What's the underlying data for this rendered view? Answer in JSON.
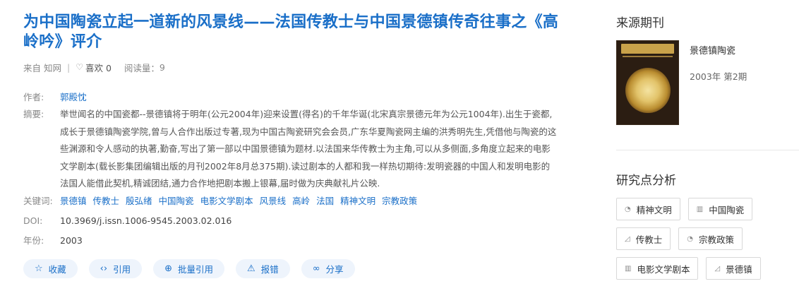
{
  "article": {
    "title": "为中国陶瓷立起一道新的风景线——法国传教士与中国景德镇传奇往事之《高岭吟》评介",
    "source": "来自 知网",
    "separator": "|",
    "like_label": "喜欢 0",
    "read_label": "阅读量：",
    "read_count": "9"
  },
  "fields": {
    "author_label": "作者:",
    "author": "郭殿忱",
    "abstract_label": "摘要:",
    "abstract": "举世闻名的中国瓷都--景德镇将于明年(公元2004年)迎来设置(得名)的千年华诞(北宋真宗景德元年为公元1004年).出生于瓷都,成长于景德镇陶瓷学院,曾与人合作出版过专著,现为中国古陶瓷研究会会员,广东华夏陶瓷网主编的洪秀明先生,凭借他与陶瓷的这些渊源和令人感动的执著,勤奋,写出了第一部以中国景德镇为题材.以法国来华传教士为主角,可以从多侧面,多角度立起来的电影文学剧本(载长影集团编辑出版的月刊2002年8月总375期).读过剧本的人都和我一样热切期待:发明瓷器的中国人和发明电影的法国人能借此契机,精诚团结,通力合作地把剧本搬上银幕,届时做为庆典献礼片公映.",
    "keywords_label": "关键词:",
    "keywords": [
      "景德镇",
      "传教士",
      "殷弘绪",
      "中国陶瓷",
      "电影文学剧本",
      "风景线",
      "高岭",
      "法国",
      "精神文明",
      "宗教政策"
    ],
    "doi_label": "DOI:",
    "doi": "10.3969/j.issn.1006-9545.2003.02.016",
    "year_label": "年份:",
    "year": "2003"
  },
  "actions": [
    {
      "label": "收藏",
      "icon": "star-icon",
      "glyph": "☆"
    },
    {
      "label": "引用",
      "icon": "code-icon",
      "glyph": "‹›"
    },
    {
      "label": "批量引用",
      "icon": "batch-icon",
      "glyph": "⊕"
    },
    {
      "label": "报错",
      "icon": "warning-icon",
      "glyph": "⚠"
    },
    {
      "label": "分享",
      "icon": "share-icon",
      "glyph": "∞"
    }
  ],
  "sidebar": {
    "source_title": "来源期刊",
    "journal_name": "景德镇陶瓷",
    "journal_issue": "2003年 第2期",
    "analysis_title": "研究点分析",
    "tags": [
      {
        "label": "精神文明",
        "icon": "pie-chart-icon",
        "glyph": "◔"
      },
      {
        "label": "中国陶瓷",
        "icon": "bar-chart-icon",
        "glyph": "▥"
      },
      {
        "label": "传教士",
        "icon": "area-chart-icon",
        "glyph": "◿"
      },
      {
        "label": "宗教政策",
        "icon": "pie-chart-icon",
        "glyph": "◔"
      },
      {
        "label": "电影文学剧本",
        "icon": "bar-chart-icon",
        "glyph": "▥"
      },
      {
        "label": "景德镇",
        "icon": "area-chart-icon",
        "glyph": "◿"
      }
    ]
  }
}
